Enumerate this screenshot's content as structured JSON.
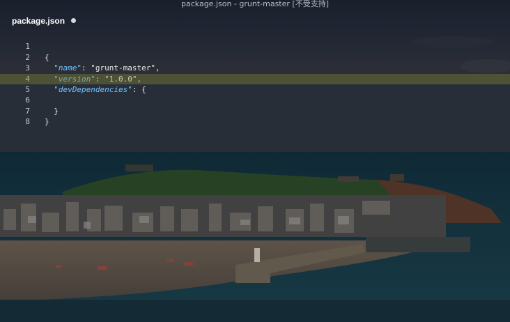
{
  "window": {
    "title": "package.json - grunt-master [不受支持]"
  },
  "tab": {
    "filename": "package.json",
    "modified_indicator": "dirty-dot-icon"
  },
  "editor": {
    "lines": [
      {
        "num": "1",
        "text": "{"
      },
      {
        "num": "2",
        "indent": "  ",
        "key": "\"name\"",
        "sep": ": ",
        "value": "\"grunt-master\","
      },
      {
        "num": "3",
        "indent": "  ",
        "key": "\"version\"",
        "sep": ": ",
        "value": "\"1.0.0\","
      },
      {
        "num": "4",
        "indent": "  ",
        "key": "\"devDependencies\"",
        "sep": ": ",
        "value": "{"
      },
      {
        "num": "5",
        "text": ""
      },
      {
        "num": "6",
        "text": "  }"
      },
      {
        "num": "7",
        "text": "}"
      },
      {
        "num": "8",
        "text": ""
      }
    ]
  },
  "colors": {
    "key": "#6fc3ff",
    "text": "#e8e8e8",
    "current_line": "#8c8c32"
  }
}
